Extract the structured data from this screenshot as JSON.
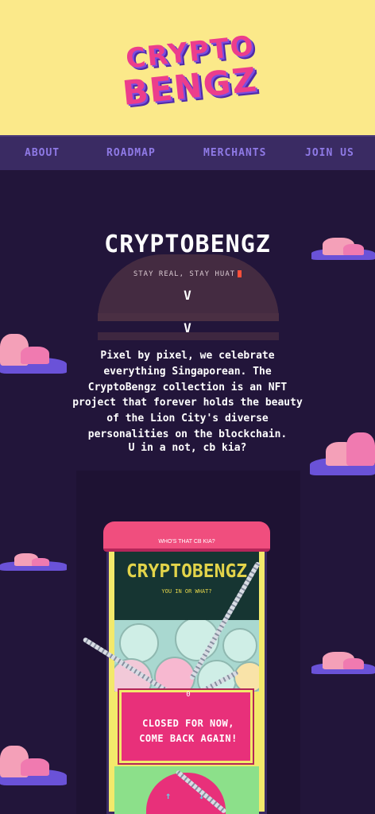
{
  "brand": {
    "logo_line1": "CRYPTO",
    "logo_line2": "BENGZ"
  },
  "nav": {
    "items": [
      {
        "label": "ABOUT"
      },
      {
        "label": "ROADMAP"
      },
      {
        "label": "MERCHANTS"
      },
      {
        "label": "JOIN US"
      }
    ]
  },
  "hero": {
    "title": "CRYPTOBENGZ",
    "tagline": "STAY REAL, STAY HUAT",
    "chevron": "V"
  },
  "about": {
    "description": "Pixel by pixel, we celebrate everything Singaporean. The CryptoBengz collection is an NFT project that forever holds the beauty of the Lion City's diverse personalities on the blockchain.",
    "question": "U in a not, cb kia?"
  },
  "machine": {
    "top_label": "WHO'S THAT CB KIA?",
    "screen_title": "CRYPTOBENGZ",
    "screen_subtitle": "YOU IN OR WHAT?",
    "sign_line1": "CLOSED FOR NOW,",
    "sign_line2": "COME BACK AGAIN!",
    "sign_counter": "0",
    "arrow_up": "↑",
    "arrow_down": "↓"
  },
  "colors": {
    "background": "#22153a",
    "header": "#fbe98a",
    "nav": "#3a2b63",
    "nav_text": "#8f7ae6",
    "accent_pink": "#ec3d8c"
  }
}
